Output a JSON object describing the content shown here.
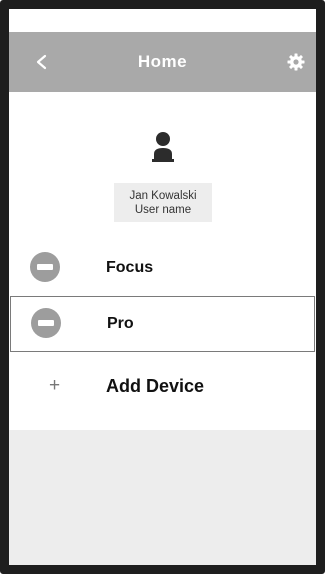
{
  "header": {
    "title": "Home",
    "back_icon": "chevron-left-icon",
    "settings_icon": "gear-icon",
    "color": "#a9a9a9"
  },
  "profile": {
    "name": "Jan Kowalski",
    "subtitle": "User name",
    "avatar_icon": "person-icon"
  },
  "devices": [
    {
      "label": "Focus",
      "icon": "device-icon",
      "selected": false
    },
    {
      "label": "Pro",
      "icon": "device-icon",
      "selected": true
    }
  ],
  "add_device": {
    "label": "Add Device",
    "icon": "plus-icon"
  }
}
